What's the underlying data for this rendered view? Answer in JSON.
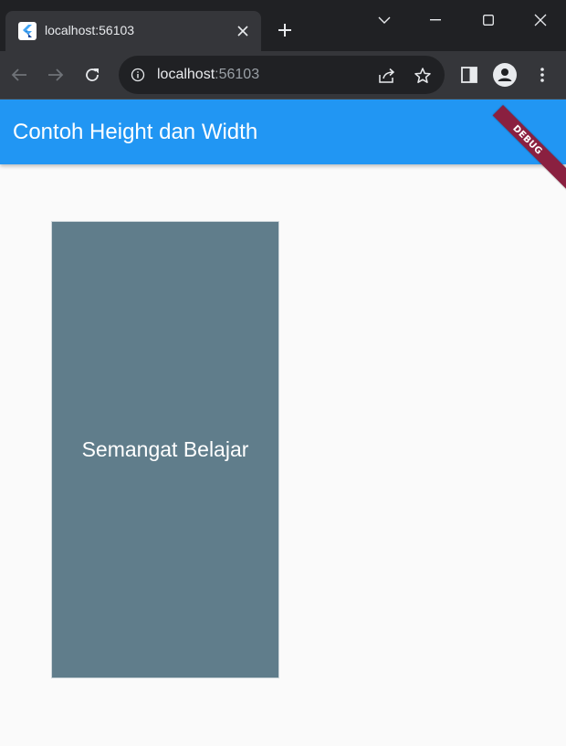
{
  "browser": {
    "tab": {
      "title": "localhost:56103",
      "favicon": "flutter-icon"
    },
    "address": {
      "host": "localhost",
      "port": ":56103"
    },
    "icons": {
      "back": "arrow-left-icon",
      "forward": "arrow-right-icon",
      "reload": "reload-icon",
      "info": "info-icon",
      "share": "share-icon",
      "bookmark": "star-icon",
      "side_panel": "side-panel-icon",
      "profile": "profile-icon",
      "menu": "kebab-menu-icon"
    }
  },
  "app": {
    "appbar_title": "Contoh Height dan Width",
    "debug_banner": "DEBUG",
    "box_text": "Semangat Belajar",
    "colors": {
      "appbar": "#2196f3",
      "box": "#607d8b",
      "debug_banner": "#8a2040"
    }
  }
}
